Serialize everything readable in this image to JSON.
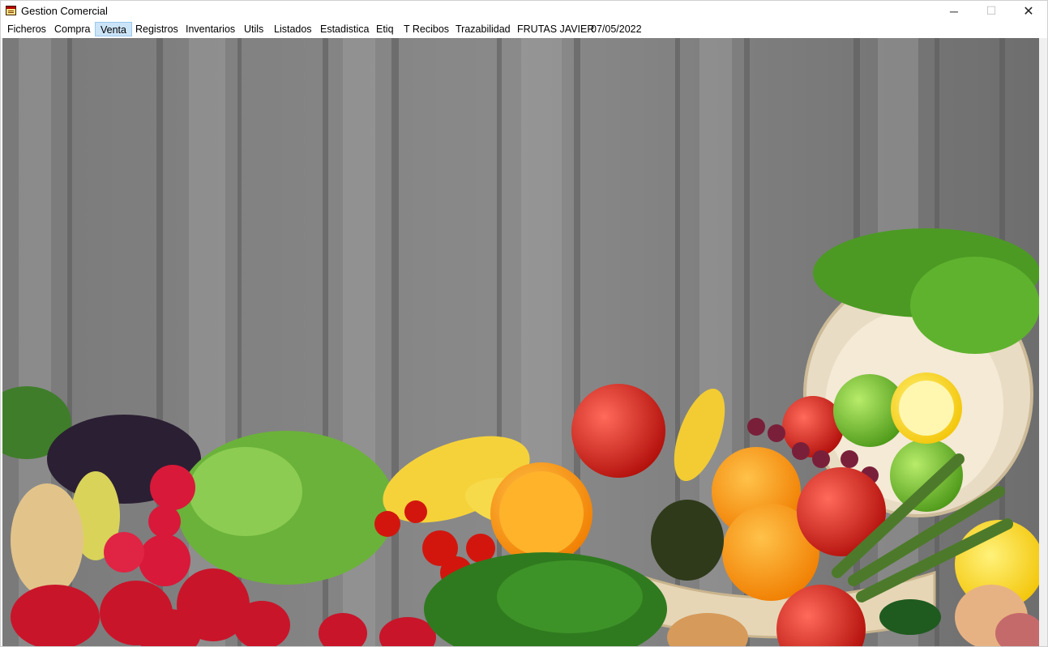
{
  "window": {
    "title": "Gestion Comercial",
    "controls": {
      "minimize": "─",
      "maximize": "☐",
      "close": "✕"
    }
  },
  "menu": {
    "items": [
      {
        "label": "Ficheros"
      },
      {
        "label": "Compra"
      },
      {
        "label": "Venta"
      },
      {
        "label": "Registros"
      },
      {
        "label": "Inventarios"
      },
      {
        "label": "Utils"
      },
      {
        "label": "Listados"
      },
      {
        "label": "Estadistica"
      },
      {
        "label": "Etiq"
      },
      {
        "label": "T Recibos"
      },
      {
        "label": "Trazabilidad"
      }
    ],
    "company": "FRUTAS JAVIER",
    "date": "07/05/2022"
  },
  "background": {
    "image": "fruits-and-vegetables-on-wooden-wall"
  }
}
